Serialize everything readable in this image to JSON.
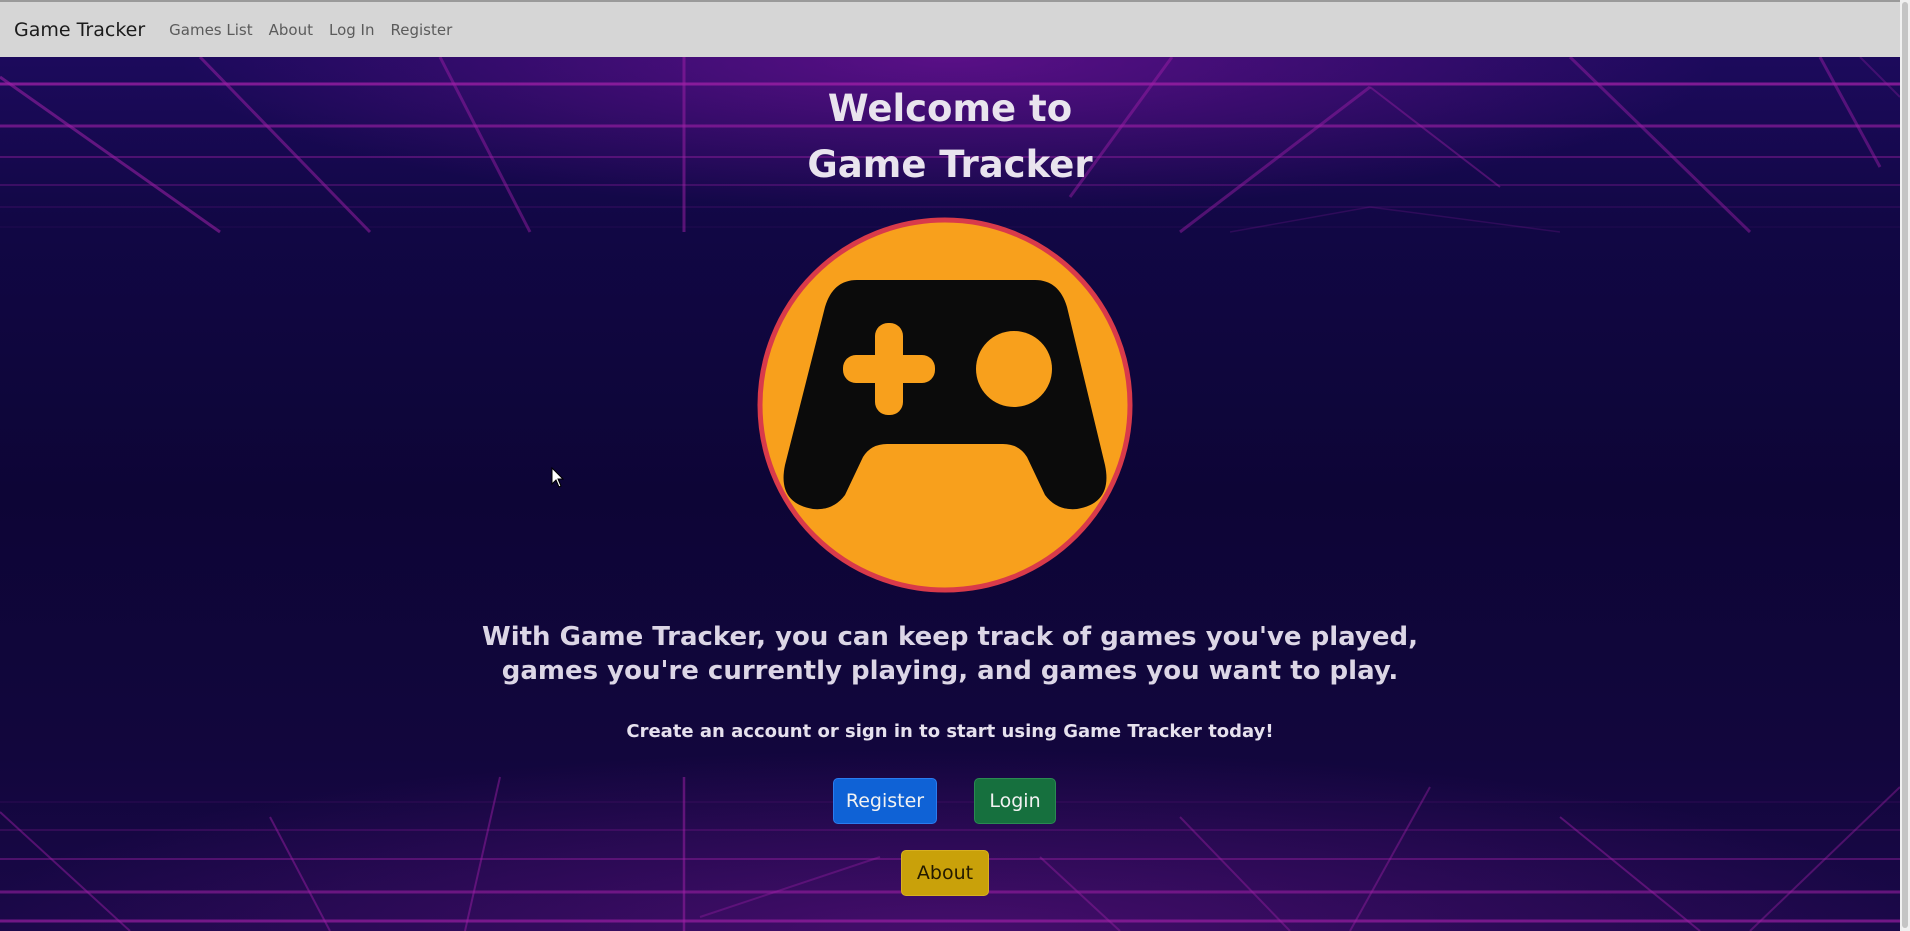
{
  "navbar": {
    "brand": "Game Tracker",
    "links": [
      "Games List",
      "About",
      "Log In",
      "Register"
    ]
  },
  "hero": {
    "title_line1": "Welcome to",
    "title_line2": "Game Tracker",
    "logo_icon": "game-controller-icon",
    "tagline_line1": "With Game Tracker, you can keep track of games you've played,",
    "tagline_line2": "games you're currently playing, and games you want to play.",
    "cta_text": "Create an account or sign in to start using Game Tracker today!",
    "buttons": {
      "register": "Register",
      "login": "Login",
      "about": "About"
    }
  },
  "colors": {
    "navbar_bg": "#d6d6d6",
    "hero_bg": "#0d0536",
    "grid_lines": "#a020a8",
    "logo_fill": "#f8a01c",
    "logo_ring": "#d93a4a",
    "register_btn": "#0f62d6",
    "login_btn": "#16703e",
    "about_btn": "#c9a10a"
  }
}
